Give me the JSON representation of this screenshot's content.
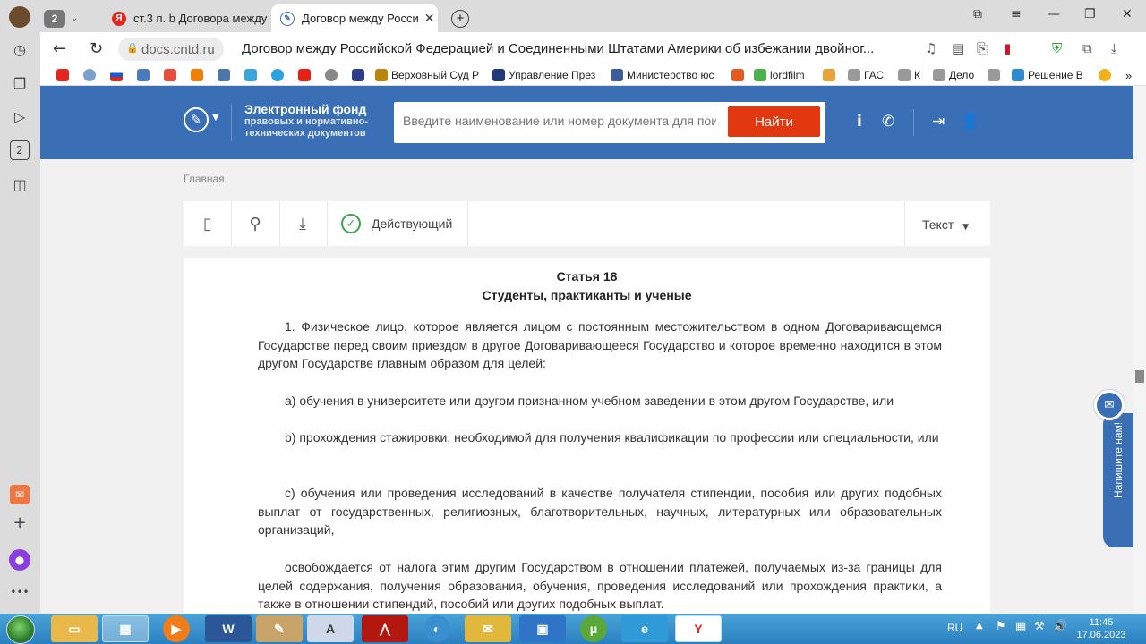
{
  "browser": {
    "tab_counter": "2",
    "tabs": [
      {
        "label": "ст.3 п. b Договора между",
        "active": false
      },
      {
        "label": "Договор между Росси",
        "active": true
      }
    ],
    "new_tab": "+",
    "domain": "docs.cntd.ru",
    "page_title": "Договор между Российской Федерацией и Соединенными Штатами Америки об избежании двойног...",
    "sidebar_badge": "2"
  },
  "bookmarks": [
    {
      "label": "Верховный Суд Р",
      "color": "#b8860b"
    },
    {
      "label": "Управление През",
      "color": "#203a7a"
    },
    {
      "label": "Министерство юс",
      "color": "#3f5c9a"
    },
    {
      "label": "lordfilm",
      "color": "#4caf50"
    },
    {
      "label": "ГАС",
      "color": "#999999"
    },
    {
      "label": "К",
      "color": "#999999"
    },
    {
      "label": "Дело",
      "color": "#999999"
    },
    {
      "label": "Решение В",
      "color": "#2e8bd0"
    }
  ],
  "site": {
    "logo_title": "Электронный фонд",
    "logo_subtitle": "правовых и нормативно-технических документов",
    "search_placeholder": "Введите наименование или номер документа для поиска",
    "search_button": "Найти"
  },
  "content": {
    "breadcrumb": "Главная",
    "status": "Действующий",
    "view_select": "Текст",
    "article_number": "Статья 18",
    "article_title": "Студенты, практиканты и ученые",
    "paragraphs": [
      "1. Физическое лицо, которое является лицом с постоянным местожительством в одном Договаривающемся Государстве перед своим приездом в другое Договаривающееся Государство и которое временно находится в этом другом Государстве главным образом для целей:",
      "a) обучения в университете или другом признанном учебном заведении в этом другом Государстве, или",
      "b) прохождения стажировки, необходимой для получения квалификации по профессии или специальности, или",
      "c) обучения или проведения исследований в качестве получателя стипендии, пособия или других подобных выплат от государственных, религиозных, благотворительных, научных, литературных или образовательных организаций,",
      "освобождается от налога этим другим Государством в отношении платежей, получаемых из-за границы для целей содержания, получения образования, обучения, проведения исследований или прохождения практики, а также в отношении стипендий, пособий или других подобных выплат."
    ]
  },
  "widget": {
    "chat_label": "Напишите нам!"
  },
  "taskbar": {
    "lang": "RU",
    "time": "11:45",
    "date": "17.06.2023"
  },
  "colors": {
    "header_blue": "#3a6fb5",
    "search_button": "#e2380f",
    "status_green": "#3aa54b"
  }
}
